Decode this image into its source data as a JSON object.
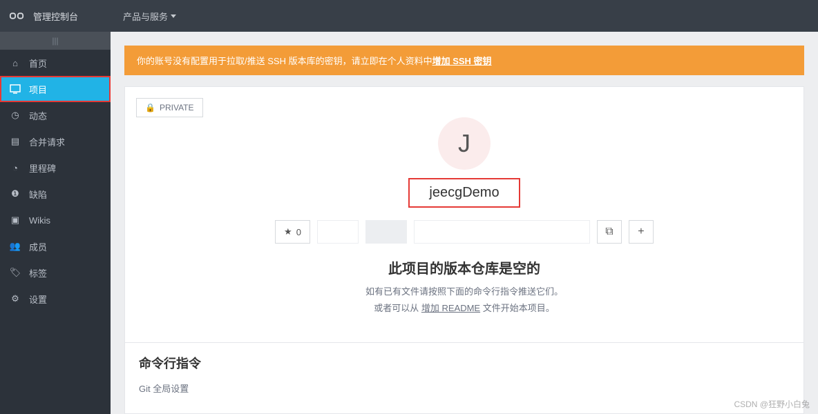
{
  "topbar": {
    "console": "管理控制台",
    "products": "产品与服务"
  },
  "sidebar": {
    "items": [
      {
        "icon": "home",
        "label": "首页"
      },
      {
        "icon": "monitor",
        "label": "项目"
      },
      {
        "icon": "gauge",
        "label": "动态"
      },
      {
        "icon": "list",
        "label": "合并请求"
      },
      {
        "icon": "clock",
        "label": "里程碑"
      },
      {
        "icon": "alert",
        "label": "缺陷"
      },
      {
        "icon": "book",
        "label": "Wikis"
      },
      {
        "icon": "users",
        "label": "成员"
      },
      {
        "icon": "tag",
        "label": "标签"
      },
      {
        "icon": "gear",
        "label": "设置"
      }
    ]
  },
  "alert": {
    "prefix": "你的账号没有配置用于拉取/推送 SSH 版本库的密钥，请立即在个人资料中",
    "link": "增加 SSH 密钥"
  },
  "project": {
    "badge": "PRIVATE",
    "avatarLetter": "J",
    "name": "jeecgDemo",
    "starCount": "0"
  },
  "emptyRepo": {
    "title": "此项目的版本仓库是空的",
    "line1": "如有已有文件请按照下面的命令行指令推送它们。",
    "line2_prefix": "或者可以从 ",
    "line2_link": "增加 README",
    "line2_suffix": " 文件开始本项目。"
  },
  "cmd": {
    "title": "命令行指令",
    "subtitle": "Git 全局设置"
  },
  "watermark": "CSDN @狂野小白兔"
}
